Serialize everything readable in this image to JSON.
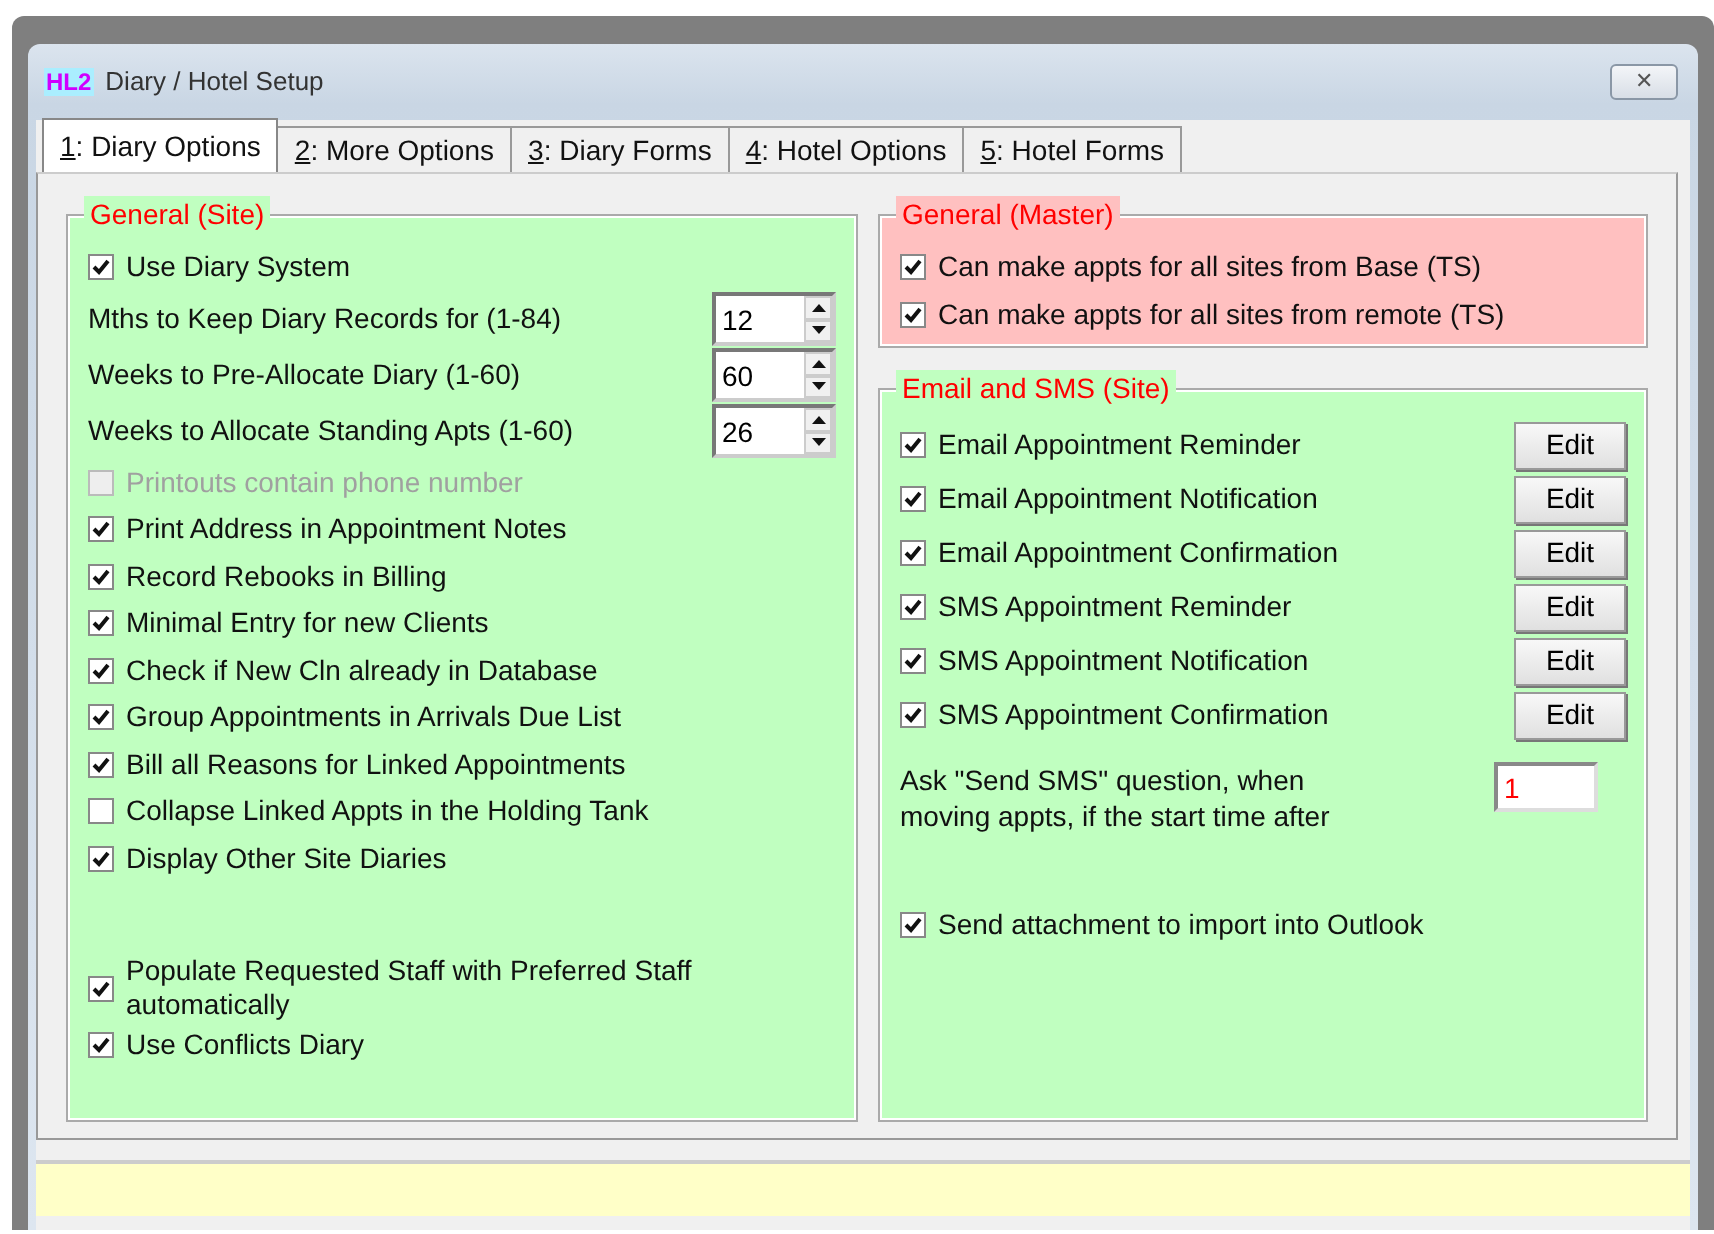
{
  "window": {
    "icon_text": "HL2",
    "title": "Diary / Hotel Setup",
    "close_glyph": "✕"
  },
  "tabs": [
    {
      "label": "1: Diary Options",
      "selected": true
    },
    {
      "label": "2: More Options",
      "selected": false
    },
    {
      "label": "3: Diary Forms",
      "selected": false
    },
    {
      "label": "4: Hotel Options",
      "selected": false
    },
    {
      "label": "5: Hotel Forms",
      "selected": false
    }
  ],
  "general_site": {
    "title": "General (Site)",
    "items": [
      {
        "kind": "check",
        "label": "Use Diary System",
        "checked": true,
        "disabled": false
      },
      {
        "kind": "spin",
        "label": "Mths to Keep Diary Records for  (1-84)",
        "value": "12"
      },
      {
        "kind": "spin",
        "label": "Weeks to Pre-Allocate Diary  (1-60)",
        "value": "60"
      },
      {
        "kind": "spin",
        "label": "Weeks to Allocate Standing Apts  (1-60)",
        "value": "26"
      },
      {
        "kind": "check",
        "label": "Printouts contain phone number",
        "checked": false,
        "disabled": true
      },
      {
        "kind": "check",
        "label": "Print Address in Appointment Notes",
        "checked": true,
        "disabled": false
      },
      {
        "kind": "check",
        "label": "Record Rebooks in Billing",
        "checked": true,
        "disabled": false
      },
      {
        "kind": "check",
        "label": "Minimal Entry for new Clients",
        "checked": true,
        "disabled": false
      },
      {
        "kind": "check",
        "label": "Check if New Cln already in Database",
        "checked": true,
        "disabled": false
      },
      {
        "kind": "check",
        "label": "Group Appointments in Arrivals Due List",
        "checked": true,
        "disabled": false
      },
      {
        "kind": "check",
        "label": "Bill all Reasons for Linked Appointments",
        "checked": true,
        "disabled": false
      },
      {
        "kind": "check",
        "label": "Collapse Linked Appts in the Holding Tank",
        "checked": false,
        "disabled": false
      },
      {
        "kind": "check",
        "label": "Display Other Site Diaries",
        "checked": true,
        "disabled": false
      },
      {
        "kind": "spacer"
      },
      {
        "kind": "check",
        "label": "Populate Requested Staff with Preferred Staff automatically",
        "checked": true,
        "disabled": false
      },
      {
        "kind": "check",
        "label": "Use Conflicts Diary",
        "checked": true,
        "disabled": false
      }
    ]
  },
  "general_master": {
    "title": "General (Master)",
    "items": [
      {
        "label": "Can make appts for all sites from Base (TS)",
        "checked": true
      },
      {
        "label": "Can make appts for all sites from remote (TS)",
        "checked": true
      }
    ]
  },
  "email_sms": {
    "title": "Email and SMS (Site)",
    "items": [
      {
        "label": "Email Appointment Reminder",
        "checked": true,
        "button": "Edit"
      },
      {
        "label": "Email Appointment Notification",
        "checked": true,
        "button": "Edit"
      },
      {
        "label": "Email Appointment Confirmation",
        "checked": true,
        "button": "Edit"
      },
      {
        "label": "SMS Appointment Reminder",
        "checked": true,
        "button": "Edit"
      },
      {
        "label": "SMS Appointment Notification",
        "checked": true,
        "button": "Edit"
      },
      {
        "label": "SMS Appointment Confirmation",
        "checked": true,
        "button": "Edit"
      }
    ],
    "ask_label": "Ask \"Send SMS\" question, when moving appts, if the start time after",
    "ask_value": "1",
    "attachment": {
      "label": "Send attachment to import into Outlook",
      "checked": true
    }
  }
}
